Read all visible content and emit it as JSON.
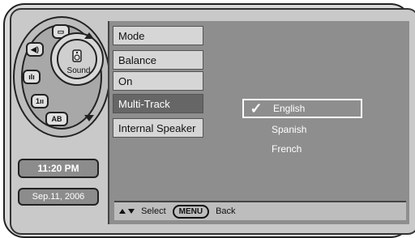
{
  "dial": {
    "center_label": "Sound",
    "ab_label": "AB"
  },
  "clock": {
    "time": "11:20 PM",
    "date": "Sep.11, 2006"
  },
  "menu": {
    "items": [
      {
        "label": "Mode"
      },
      {
        "label": "Balance"
      },
      {
        "label": "On"
      },
      {
        "label": "Multi-Track"
      },
      {
        "label": "Internal Speaker"
      }
    ]
  },
  "options": {
    "items": [
      {
        "label": "English"
      },
      {
        "label": "Spanish"
      },
      {
        "label": "French"
      }
    ],
    "checkmark": "✓"
  },
  "footer": {
    "select_label": "Select",
    "menu_key": "MENU",
    "back_label": "Back"
  }
}
